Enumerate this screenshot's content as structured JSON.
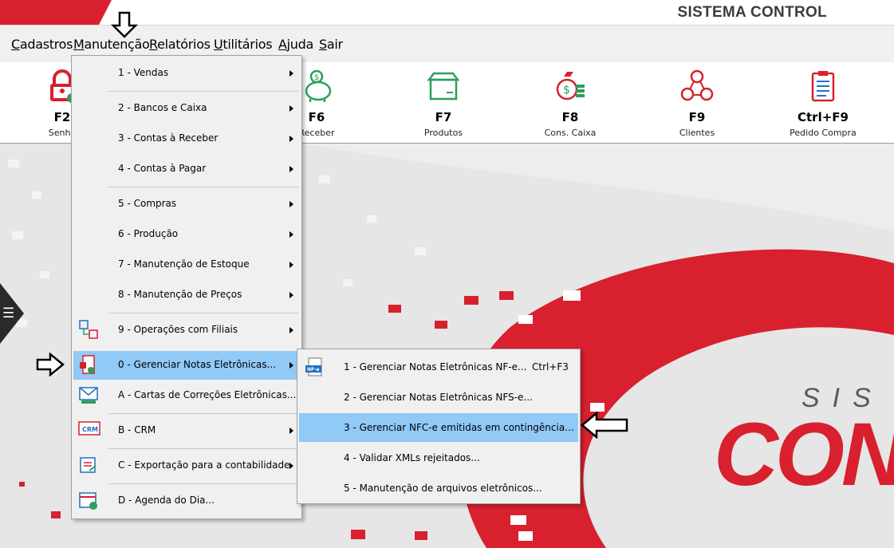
{
  "app_title": "SISTEMA CONTROL",
  "menubar": [
    {
      "underline": "C",
      "rest": "adastros"
    },
    {
      "underline": "M",
      "rest": "anutenção"
    },
    {
      "underline": "R",
      "rest": "elatórios"
    },
    {
      "underline": "U",
      "rest": "tilitários"
    },
    {
      "underline": "A",
      "rest": "juda"
    },
    {
      "underline": "S",
      "rest": "air"
    }
  ],
  "toolbar": [
    {
      "key": "F2",
      "label": "Senha",
      "icon": "lock-icon"
    },
    {
      "key": "F6",
      "label": "Receber",
      "icon": "piggy-bank-icon"
    },
    {
      "key": "F7",
      "label": "Produtos",
      "icon": "box-icon"
    },
    {
      "key": "F8",
      "label": "Cons. Caixa",
      "icon": "money-bag-icon"
    },
    {
      "key": "F9",
      "label": "Clientes",
      "icon": "people-network-icon"
    },
    {
      "key": "Ctrl+F9",
      "label": "Pedido Compra",
      "icon": "clipboard-list-icon"
    }
  ],
  "main_menu": [
    "1 - Vendas",
    "2 - Bancos e Caixa",
    "3 - Contas à Receber",
    "4 - Contas à Pagar",
    "5 - Compras",
    "6 - Produção",
    "7 - Manutenção de Estoque",
    "8 - Manutenção de Preços",
    "9 - Operações com Filiais",
    "0 - Gerenciar Notas Eletrônicas...",
    "A - Cartas de Correções Eletrônicas...",
    "B - CRM",
    "C - Exportação para a contabilidade",
    "D - Agenda do Dia..."
  ],
  "sub_menu": [
    {
      "label": "1 - Gerenciar Notas Eletrônicas NF-e...",
      "shortcut": "Ctrl+F3"
    },
    {
      "label": "2 - Gerenciar Notas Eletrônicas NFS-e...",
      "shortcut": ""
    },
    {
      "label": "3 - Gerenciar NFC-e emitidas em contingência...",
      "shortcut": ""
    },
    {
      "label": "4 - Validar XMLs rejeitados...",
      "shortcut": ""
    },
    {
      "label": "5 - Manutenção de arquivos eletrônicos...",
      "shortcut": ""
    }
  ],
  "logo": {
    "top": "SIS",
    "bottom": "CON"
  },
  "colors": {
    "brand_red": "#d8202e",
    "highlight": "#91c9f7",
    "menu_bg": "#f0f0f0",
    "icon_green": "#2e9e5a"
  }
}
